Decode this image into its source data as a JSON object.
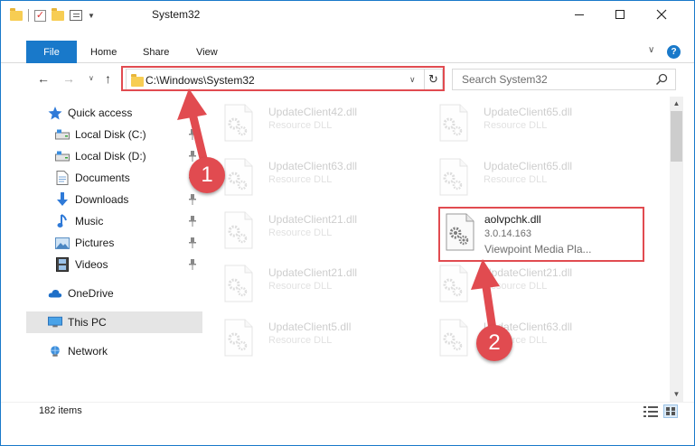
{
  "window": {
    "title": "System32"
  },
  "ribbon": {
    "tabs": [
      "File",
      "Home",
      "Share",
      "View"
    ],
    "help": "?"
  },
  "nav": {
    "address": "C:\\Windows\\System32",
    "search_placeholder": "Search System32"
  },
  "sidebar": {
    "items": [
      {
        "label": "Quick access",
        "icon": "star-icon",
        "pinned": false
      },
      {
        "label": "Local Disk (C:)",
        "icon": "drive-icon",
        "pinned": true
      },
      {
        "label": "Local Disk (D:)",
        "icon": "drive-icon",
        "pinned": true
      },
      {
        "label": "Documents",
        "icon": "documents-icon",
        "pinned": true
      },
      {
        "label": "Downloads",
        "icon": "download-arrow-icon",
        "pinned": true
      },
      {
        "label": "Music",
        "icon": "music-note-icon",
        "pinned": true
      },
      {
        "label": "Pictures",
        "icon": "pictures-icon",
        "pinned": true
      },
      {
        "label": "Videos",
        "icon": "film-icon",
        "pinned": true
      },
      {
        "label": "OneDrive",
        "icon": "cloud-icon",
        "pinned": false
      },
      {
        "label": "This PC",
        "icon": "monitor-icon",
        "pinned": false,
        "selected": true
      },
      {
        "label": "Network",
        "icon": "network-icon",
        "pinned": false
      }
    ]
  },
  "files": {
    "left_column": [
      {
        "name": "UpdateClient42.dll",
        "type": "Resource DLL"
      },
      {
        "name": "UpdateClient63.dll",
        "type": "Resource DLL"
      },
      {
        "name": "UpdateClient21.dll",
        "type": "Resource DLL"
      },
      {
        "name": "UpdateClient21.dll",
        "type": "Resource DLL"
      },
      {
        "name": "UpdateClient5.dll",
        "type": "Resource DLL"
      }
    ],
    "right_column": [
      {
        "name": "UpdateClient65.dll",
        "type": "Resource DLL"
      },
      {
        "name": "UpdateClient65.dll",
        "type": "Resource DLL"
      },
      {
        "name": "UpdateClient21.dll",
        "type": "Resource DLL"
      },
      {
        "name": "UpdateClient63.dll",
        "type": "Resource DLL"
      }
    ],
    "highlighted": {
      "name": "aolvpchk.dll",
      "version": "3.0.14.163",
      "description": "Viewpoint Media Pla..."
    }
  },
  "status": {
    "item_count": "182 items"
  },
  "annotations": {
    "badge_1": "1",
    "badge_2": "2",
    "color": "#e14b50"
  }
}
